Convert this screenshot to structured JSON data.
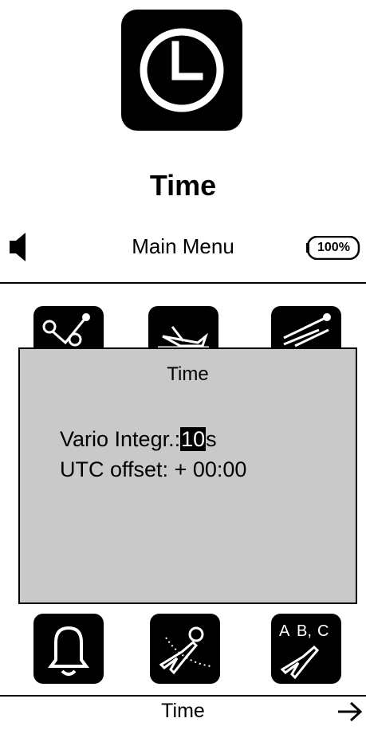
{
  "page": {
    "title": "Time"
  },
  "icons": {
    "hero": "clock-icon"
  },
  "header": {
    "title": "Main Menu",
    "battery": "100%"
  },
  "menu_row_top": [
    "route-waypoints-icon",
    "airplane-landing-icon",
    "launch-trails-icon"
  ],
  "menu_row_bottom": [
    "bell-icon",
    "airplane-settings-icon",
    "airplane-abc-icon"
  ],
  "dialog": {
    "title": "Time",
    "vario_label": "Vario Integr.:",
    "vario_value": "10",
    "vario_unit": "s",
    "utc_label": "UTC offset:",
    "utc_sign": "+",
    "utc_value": "00:00"
  },
  "footer": {
    "title": "Time"
  }
}
